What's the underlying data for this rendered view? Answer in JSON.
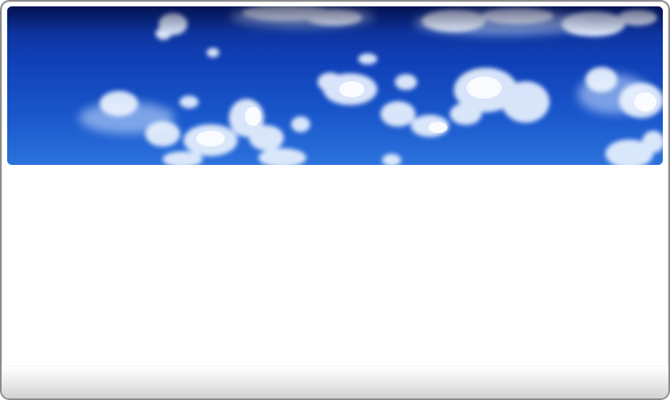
{
  "window": {
    "background_color": "#ffffff",
    "border_color": "#8a8a8a"
  },
  "header": {
    "image": "sky-with-clouds",
    "sky_colors": [
      "#0a2a88",
      "#1a58cc",
      "#2c72dc"
    ],
    "cloud_color": "#e8f2ff"
  },
  "content": {},
  "footer": {
    "gradient_colors": [
      "#ffffff",
      "#d2d2d2"
    ]
  }
}
